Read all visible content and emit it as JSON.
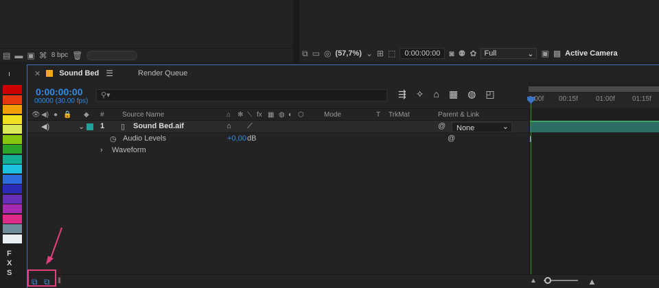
{
  "project_bar": {
    "bpc_label": "8 bpc"
  },
  "comp_bar": {
    "zoom_label": "(57,7%)",
    "timecode": "0:00:00:00",
    "resolution": "Full",
    "camera": "Active Camera"
  },
  "tabs": [
    {
      "label": "Sound Bed",
      "color": "#f5a623"
    },
    {
      "label": "Render Queue"
    }
  ],
  "timeline": {
    "timecode": "0:00:00:00",
    "fps": "00000 (30.00 fps)",
    "search_placeholder": "⚲▾",
    "columns": {
      "hash": "#",
      "source_name": "Source Name",
      "mode": "Mode",
      "t": "T",
      "trkmat": "TrkMat",
      "parent_link": "Parent & Link"
    },
    "layers": [
      {
        "number": "1",
        "name": "Sound Bed.aif",
        "label_color": "#1fa39a",
        "parent": "None",
        "properties": [
          {
            "name": "Audio Levels",
            "value": "+0,00",
            "unit": "dB"
          },
          {
            "name": "Waveform"
          }
        ]
      }
    ],
    "ruler_ticks": [
      "1:00f",
      "00:15f",
      "01:00f",
      "01:15f"
    ]
  },
  "swatches": [
    "#cc0000",
    "#e8380d",
    "#f5a000",
    "#f0e020",
    "#d9e855",
    "#84c70e",
    "#2aa52a",
    "#0fae95",
    "#1ec0e0",
    "#2d6be0",
    "#2b2bb8",
    "#6a2fb8",
    "#a82ab0",
    "#e02a8a",
    "#6e8c9c",
    "#e8eef2"
  ],
  "swatch_letters": [
    "F",
    "X",
    "S"
  ],
  "accent_color": "#2d8ceb",
  "highlight_color": "#e2407f"
}
